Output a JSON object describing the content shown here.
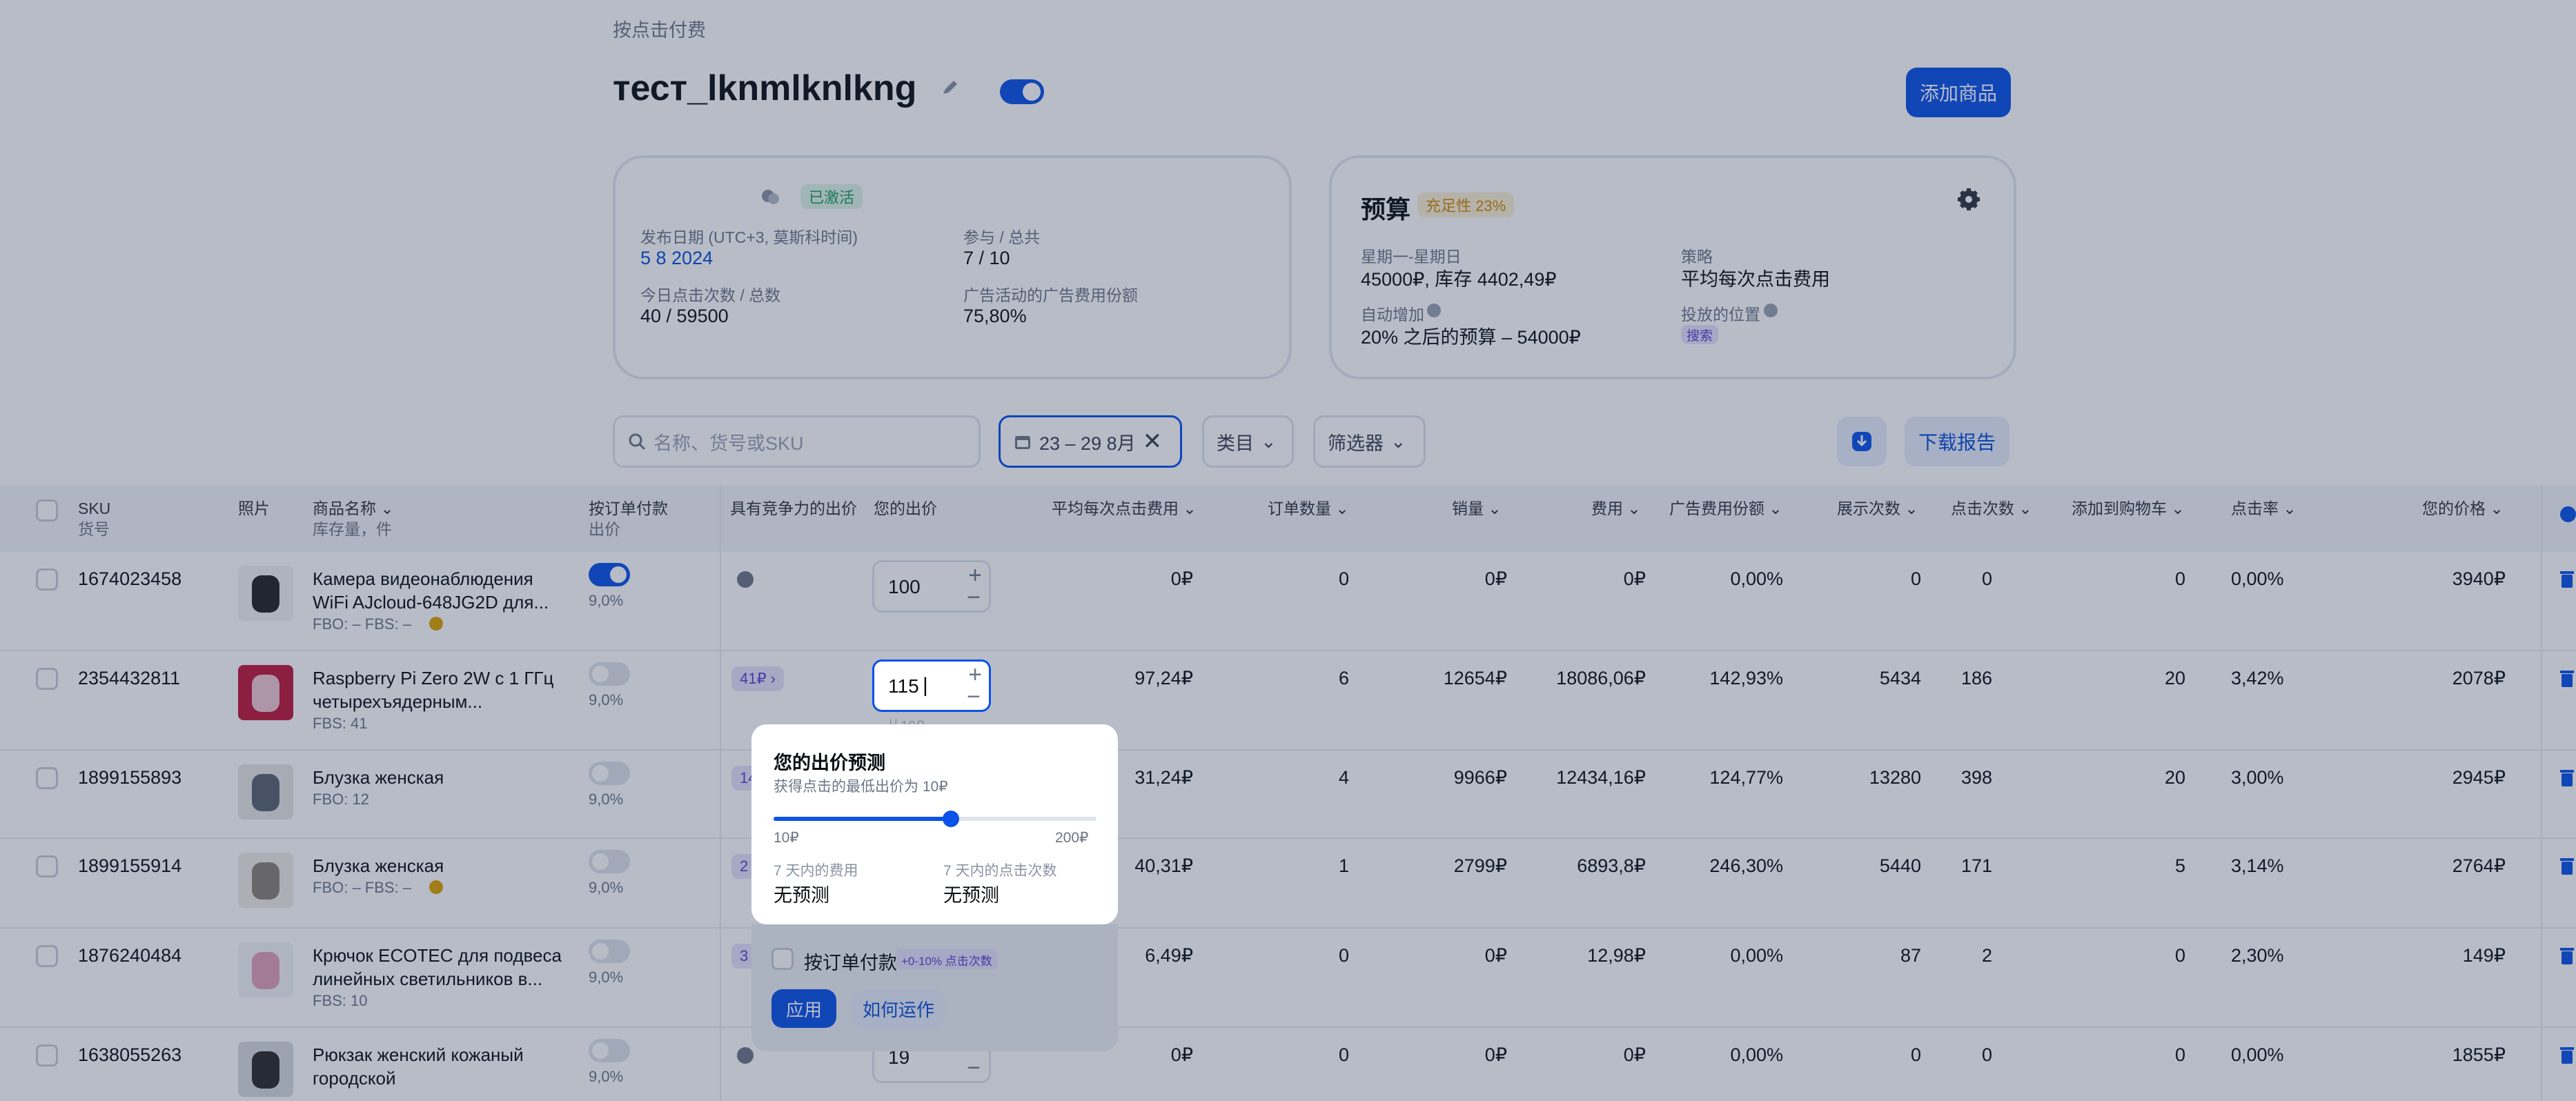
{
  "breadcrumb": "按点击付费",
  "campaign": {
    "title": "тест_lknmlknlkng",
    "add_button": "添加商品"
  },
  "info_card": {
    "status": "已激活",
    "launch_label": "发布日期 (UTC+3, 莫斯科时间)",
    "launch_value": "5 8 2024",
    "participate_label": "参与 / 总共",
    "participate_value": "7 / 10",
    "clicks_label": "今日点击次数 / 总数",
    "clicks_value": "40 / 59500",
    "share_label": "广告活动的广告费用份额",
    "share_value": "75,80%"
  },
  "budget_card": {
    "title": "预算",
    "badge": "充足性 23%",
    "days_label": "星期一-星期日",
    "days_value": "45000₽, 库存 4402,49₽",
    "strategy_label": "策略",
    "strategy_value": "平均每次点击费用",
    "auto_label": "自动增加",
    "auto_value": "20% 之后的预算 – 54000₽",
    "placement_label": "投放的位置",
    "placement_value": "搜索"
  },
  "toolbar": {
    "search_placeholder": "名称、货号或SKU",
    "date_range": "23 – 29 8月",
    "category": "类目",
    "filters": "筛选器",
    "report_button": "下载报告"
  },
  "table": {
    "headers": {
      "sku": "SKU",
      "sku_sub": "货号",
      "photo": "照片",
      "name": "商品名称",
      "name_sub": "库存量，件",
      "cpo": "按订单付款",
      "cpo_sub": "出价",
      "competitive": "具有竞争力的出价",
      "your_bid": "您的出价",
      "avg_cpc": "平均每次点击费用",
      "orders": "订单数量",
      "sales": "销量",
      "cost": "费用",
      "ad_share": "广告费用份额",
      "impressions": "展示次数",
      "clicks": "点击次数",
      "cart": "添加到购物车",
      "ctr": "点击率",
      "price": "您的价格"
    },
    "rows": [
      {
        "sku": "1674023458",
        "name1": "Камера видеонаблюдения",
        "name2": "WiFi AJcloud-648JG2D для...",
        "stock": "FBO: –   FBS: –",
        "cpo": "9,0%",
        "comp": "",
        "bid": "100",
        "avg": "0₽",
        "orders": "0",
        "sales": "0₽",
        "cost": "0₽",
        "share": "0,00%",
        "impr": "0",
        "clicks": "0",
        "cart": "0",
        "ctr": "0,00%",
        "price": "3940₽"
      },
      {
        "sku": "2354432811",
        "name1": "Raspberry Pi Zero 2W с 1 ГГц",
        "name2": "четырехъядерным...",
        "stock": "FBS: 41",
        "cpo": "9,0%",
        "comp": "41₽",
        "bid": "115",
        "bid_hint": "从10₽",
        "avg": "97,24₽",
        "orders": "6",
        "sales": "12654₽",
        "cost": "18086,06₽",
        "share": "142,93%",
        "impr": "5434",
        "clicks": "186",
        "cart": "20",
        "ctr": "3,42%",
        "price": "2078₽"
      },
      {
        "sku": "1899155893",
        "name1": "Блузка женская",
        "name2": "",
        "stock": "FBO: 12",
        "cpo": "9,0%",
        "comp": "14",
        "bid": "",
        "avg": "31,24₽",
        "orders": "4",
        "sales": "9966₽",
        "cost": "12434,16₽",
        "share": "124,77%",
        "impr": "13280",
        "clicks": "398",
        "cart": "20",
        "ctr": "3,00%",
        "price": "2945₽"
      },
      {
        "sku": "1899155914",
        "name1": "Блузка женская",
        "name2": "",
        "stock": "FBO: –   FBS: –",
        "cpo": "9,0%",
        "comp": "2",
        "bid": "",
        "avg": "40,31₽",
        "orders": "1",
        "sales": "2799₽",
        "cost": "6893,8₽",
        "share": "246,30%",
        "impr": "5440",
        "clicks": "171",
        "cart": "5",
        "ctr": "3,14%",
        "price": "2764₽"
      },
      {
        "sku": "1876240484",
        "name1": "Крючок ECOTEC для подвеса",
        "name2": "линейных светильников в...",
        "stock": "FBS: 10",
        "cpo": "9,0%",
        "comp": "3",
        "bid": "",
        "avg": "6,49₽",
        "orders": "0",
        "sales": "0₽",
        "cost": "12,98₽",
        "share": "0,00%",
        "impr": "87",
        "clicks": "2",
        "cart": "0",
        "ctr": "2,30%",
        "price": "149₽"
      },
      {
        "sku": "1638055263",
        "name1": "Рюкзак женский кожаный",
        "name2": "городской",
        "stock": "",
        "cpo": "9,0%",
        "comp": "",
        "bid": "19",
        "avg": "0₽",
        "orders": "0",
        "sales": "0₽",
        "cost": "0₽",
        "share": "0,00%",
        "impr": "0",
        "clicks": "0",
        "cart": "0",
        "ctr": "0,00%",
        "price": "1855₽"
      }
    ]
  },
  "popup": {
    "title": "您的出价预测",
    "subtitle": "获得点击的最低出价为 10₽",
    "min": "10₽",
    "max": "200₽",
    "slider_value": 0.55,
    "cost_label": "7 天内的费用",
    "cost_value": "无预测",
    "clicks_label": "7 天内的点击次数",
    "clicks_value": "无预测",
    "cpo_label": "按订单付款",
    "cpo_badge": "+0-10% 点击次数",
    "apply": "应用",
    "how": "如何运作"
  },
  "colors": {
    "accent": "#0b52e8",
    "green": "#1aa05a",
    "orange": "#d08a00"
  }
}
